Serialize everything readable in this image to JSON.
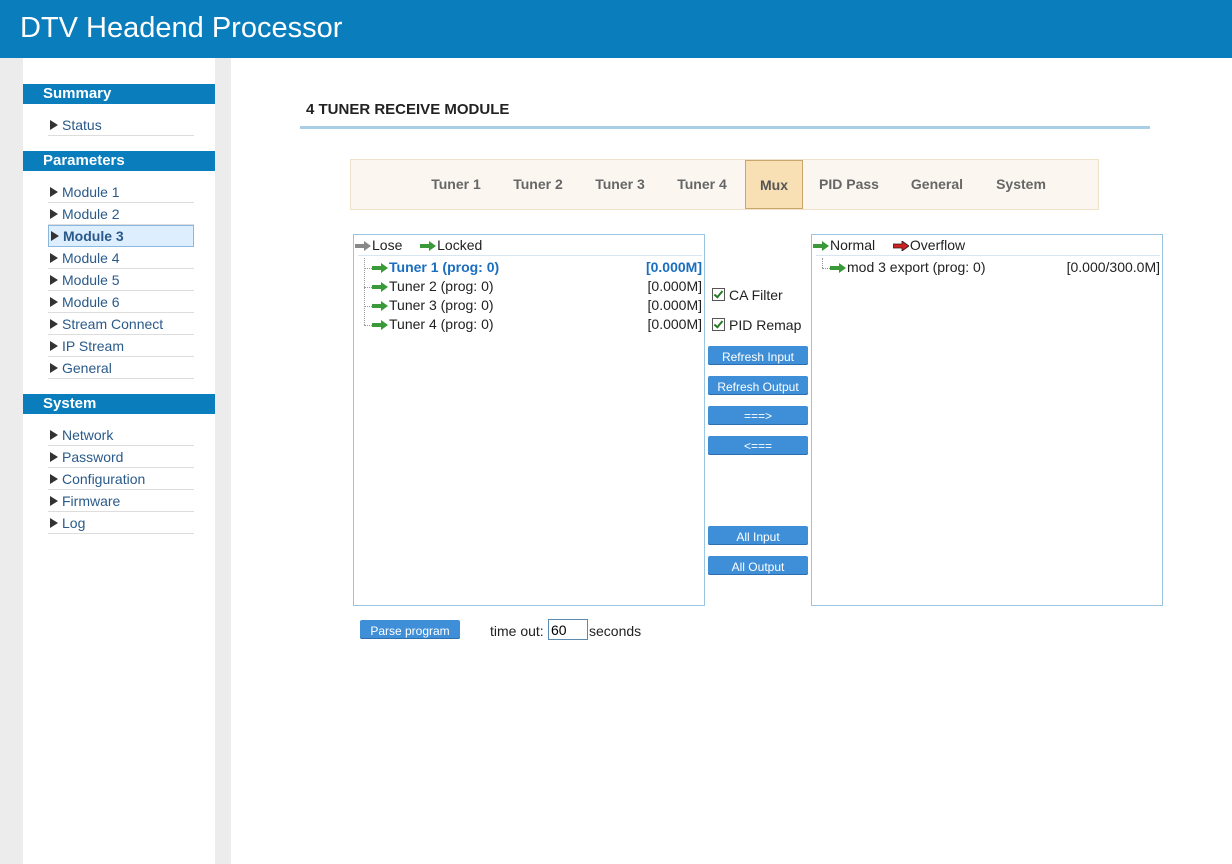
{
  "app": {
    "title": "DTV Headend Processor"
  },
  "sidebar": {
    "sections": [
      {
        "title": "Summary",
        "items": [
          {
            "label": "Status"
          }
        ]
      },
      {
        "title": "Parameters",
        "items": [
          {
            "label": "Module 1"
          },
          {
            "label": "Module 2"
          },
          {
            "label": "Module 3"
          },
          {
            "label": "Module 4"
          },
          {
            "label": "Module 5"
          },
          {
            "label": "Module 6"
          },
          {
            "label": "Stream Connect"
          },
          {
            "label": "IP Stream"
          },
          {
            "label": "General"
          }
        ]
      },
      {
        "title": "System",
        "items": [
          {
            "label": "Network"
          },
          {
            "label": "Password"
          },
          {
            "label": "Configuration"
          },
          {
            "label": "Firmware"
          },
          {
            "label": "Log"
          }
        ]
      }
    ],
    "active_item": "Module 3"
  },
  "page": {
    "title": "4 TUNER RECEIVE MODULE"
  },
  "tabs": [
    {
      "label": "Tuner 1"
    },
    {
      "label": "Tuner 2"
    },
    {
      "label": "Tuner 3"
    },
    {
      "label": "Tuner 4"
    },
    {
      "label": "Mux",
      "active": true
    },
    {
      "label": "PID Pass"
    },
    {
      "label": "General"
    },
    {
      "label": "System"
    }
  ],
  "input_panel": {
    "legend": {
      "lose": "Lose",
      "locked": "Locked"
    },
    "rows": [
      {
        "label": "Tuner 1 (prog: 0)",
        "value": "[0.000M]",
        "selected": true
      },
      {
        "label": "Tuner 2 (prog: 0)",
        "value": "[0.000M]"
      },
      {
        "label": "Tuner 3 (prog: 0)",
        "value": "[0.000M]"
      },
      {
        "label": "Tuner 4 (prog: 0)",
        "value": "[0.000M]"
      }
    ]
  },
  "output_panel": {
    "legend": {
      "normal": "Normal",
      "overflow": "Overflow"
    },
    "rows": [
      {
        "label": "mod 3 export (prog: 0)",
        "value": "[0.000/300.0M]"
      }
    ]
  },
  "options": {
    "ca_filter": "CA Filter",
    "ca_filter_checked": true,
    "pid_remap": "PID Remap",
    "pid_remap_checked": true
  },
  "buttons": {
    "refresh_input": "Refresh Input",
    "refresh_output": "Refresh Output",
    "move_right": "===>",
    "move_left": "<===",
    "all_input": "All Input",
    "all_output": "All Output",
    "parse_program": "Parse program"
  },
  "timeout": {
    "label": "time out:",
    "value": "60",
    "unit": "seconds"
  },
  "colors": {
    "header": "#0a7ebd",
    "button": "#3e8fd8",
    "locked_arrow": "#3a9a3a",
    "lose_arrow": "#888888",
    "overflow_arrow": "#d02020"
  }
}
